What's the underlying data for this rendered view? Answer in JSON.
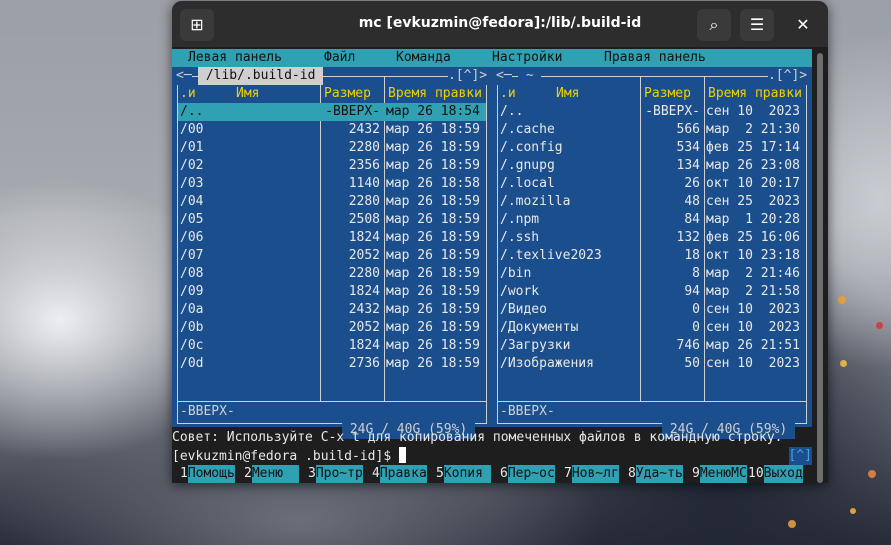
{
  "window": {
    "title": "mc [evkuzmin@fedora]:/lib/.build-id",
    "icons": {
      "new_tab": "new-tab-icon",
      "search": "search-icon",
      "menu": "hamburger-icon",
      "close": "close-icon"
    },
    "glyphs": {
      "new_tab": "⊞",
      "search": "⌕",
      "menu": "☰",
      "close": "✕"
    }
  },
  "menubar": [
    "Левая панель",
    "Файл",
    "Команда",
    "Настройки",
    "Правая панель"
  ],
  "left_panel": {
    "path": " /lib/.build-id ",
    "corner": ".[^]>",
    "open": "<─",
    "headers": {
      "n": ".и",
      "name": "Имя",
      "size": "Размер",
      "time": "Время правки"
    },
    "rows": [
      {
        "name": "/..",
        "size": "-ВВЕРХ-",
        "time": "мар 26 18:54",
        "selected": true
      },
      {
        "name": "/00",
        "size": "2432",
        "time": "мар 26 18:59"
      },
      {
        "name": "/01",
        "size": "2280",
        "time": "мар 26 18:59"
      },
      {
        "name": "/02",
        "size": "2356",
        "time": "мар 26 18:59"
      },
      {
        "name": "/03",
        "size": "1140",
        "time": "мар 26 18:58"
      },
      {
        "name": "/04",
        "size": "2280",
        "time": "мар 26 18:59"
      },
      {
        "name": "/05",
        "size": "2508",
        "time": "мар 26 18:59"
      },
      {
        "name": "/06",
        "size": "1824",
        "time": "мар 26 18:59"
      },
      {
        "name": "/07",
        "size": "2052",
        "time": "мар 26 18:59"
      },
      {
        "name": "/08",
        "size": "2280",
        "time": "мар 26 18:59"
      },
      {
        "name": "/09",
        "size": "1824",
        "time": "мар 26 18:59"
      },
      {
        "name": "/0a",
        "size": "2432",
        "time": "мар 26 18:59"
      },
      {
        "name": "/0b",
        "size": "2052",
        "time": "мар 26 18:59"
      },
      {
        "name": "/0c",
        "size": "1824",
        "time": "мар 26 18:59"
      },
      {
        "name": "/0d",
        "size": "2736",
        "time": "мар 26 18:59"
      }
    ],
    "status": "-ВВЕРХ-",
    "free": " 24G / 40G (59%) "
  },
  "right_panel": {
    "path": " ~ ",
    "corner": ".[^]>",
    "open": "<─",
    "headers": {
      "n": ".и",
      "name": "Имя",
      "size": "Размер",
      "time": "Время правки"
    },
    "rows": [
      {
        "name": "/..",
        "size": "-ВВЕРХ-",
        "time": "сен 10  2023"
      },
      {
        "name": "/.cache",
        "size": "566",
        "time": "мар  2 21:30"
      },
      {
        "name": "/.config",
        "size": "534",
        "time": "фев 25 17:14"
      },
      {
        "name": "/.gnupg",
        "size": "134",
        "time": "мар 26 23:08"
      },
      {
        "name": "/.local",
        "size": "26",
        "time": "окт 10 20:17"
      },
      {
        "name": "/.mozilla",
        "size": "48",
        "time": "сен 25  2023"
      },
      {
        "name": "/.npm",
        "size": "84",
        "time": "мар  1 20:28"
      },
      {
        "name": "/.ssh",
        "size": "132",
        "time": "фев 25 16:06"
      },
      {
        "name": "/.texlive2023",
        "size": "18",
        "time": "окт 10 23:18"
      },
      {
        "name": "/bin",
        "size": "8",
        "time": "мар  2 21:46"
      },
      {
        "name": "/work",
        "size": "94",
        "time": "мар  2 21:58"
      },
      {
        "name": "/Видео",
        "size": "0",
        "time": "сен 10  2023"
      },
      {
        "name": "/Документы",
        "size": "0",
        "time": "сен 10  2023"
      },
      {
        "name": "/Загрузки",
        "size": "746",
        "time": "мар 26 21:51"
      },
      {
        "name": "/Изображения",
        "size": "50",
        "time": "сен 10  2023"
      }
    ],
    "status": "-ВВЕРХ-",
    "free": " 24G / 40G (59%) "
  },
  "hint": "Совет: Используйте C-x t для копирования помеченных файлов в командную строку.",
  "prompt": "[evkuzmin@fedora .build-id]$ ",
  "prompt_corner": "[^]",
  "fkeys": [
    {
      "num": "1",
      "label": "Помощь"
    },
    {
      "num": "2",
      "label": "Меню  "
    },
    {
      "num": "3",
      "label": "Про~тр"
    },
    {
      "num": "4",
      "label": "Правка"
    },
    {
      "num": "5",
      "label": "Копия "
    },
    {
      "num": "6",
      "label": "Пер~ос"
    },
    {
      "num": "7",
      "label": "Нов~лг"
    },
    {
      "num": "8",
      "label": "Уда~ть"
    },
    {
      "num": "9",
      "label": "МенюMC"
    },
    {
      "num": "10",
      "label": "Выход"
    }
  ],
  "colors": {
    "panel": "#1b4e8c",
    "accent": "#30a0b3",
    "header": "#f0d000"
  }
}
